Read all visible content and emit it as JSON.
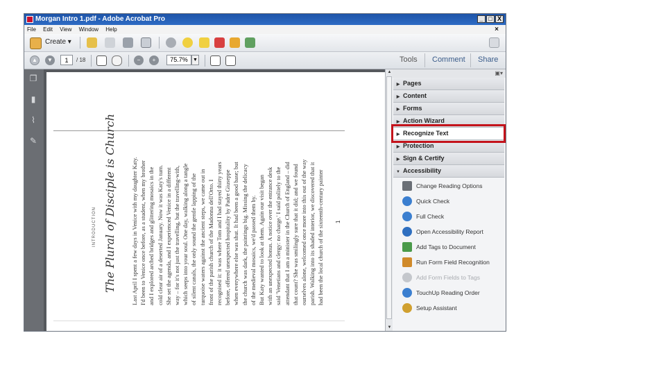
{
  "window": {
    "title": "Morgan Intro  1.pdf - Adobe Acrobat Pro",
    "min": "_",
    "max": "□",
    "close": "X"
  },
  "menu": [
    "File",
    "Edit",
    "View",
    "Window",
    "Help"
  ],
  "menu_close": "×",
  "toolbar": {
    "create_label": "Create",
    "page_current": "1",
    "page_total": "/ 18",
    "zoom": "75.7%"
  },
  "tabs": {
    "tools": "Tools",
    "comment": "Comment",
    "share": "Share"
  },
  "panel": {
    "sections": [
      {
        "label": "Pages",
        "expanded": false
      },
      {
        "label": "Content",
        "expanded": false
      },
      {
        "label": "Forms",
        "expanded": false
      },
      {
        "label": "Action Wizard",
        "expanded": false
      },
      {
        "label": "Recognize Text",
        "expanded": false,
        "highlighted": true
      },
      {
        "label": "Protection",
        "expanded": false
      },
      {
        "label": "Sign & Certify",
        "expanded": false
      },
      {
        "label": "Accessibility",
        "expanded": true
      }
    ],
    "accessibility_items": [
      {
        "label": "Change Reading Options",
        "icon": "book-icon",
        "enabled": true
      },
      {
        "label": "Quick Check",
        "icon": "check-circle-icon",
        "enabled": true
      },
      {
        "label": "Full Check",
        "icon": "full-check-icon",
        "enabled": true
      },
      {
        "label": "Open Accessibility Report",
        "icon": "report-icon",
        "enabled": true
      },
      {
        "label": "Add Tags to Document",
        "icon": "tag-icon",
        "enabled": true
      },
      {
        "label": "Run Form Field Recognition",
        "icon": "form-recognition-icon",
        "enabled": true
      },
      {
        "label": "Add Form Fields to Tags",
        "icon": "form-tags-icon",
        "enabled": false
      },
      {
        "label": "TouchUp Reading Order",
        "icon": "touchup-icon",
        "enabled": true
      },
      {
        "label": "Setup Assistant",
        "icon": "wand-icon",
        "enabled": true
      }
    ]
  },
  "document": {
    "chapter_label": "INTRODUCTION",
    "title": "The Plural of Disciple is Church",
    "page_number": "1",
    "lines": [
      "Last April I spent a few days in Venice with my daughter Katy.",
      "I'd been to Venice once before, as a student, when my brother",
      "and I explored arched bridges and glittering mosaics in the",
      "cold clear air of a deserted January. Now it was Katy's turn.",
      "She set the agenda, and I experienced Venice in a different",
      "way – for it's not just the travelling, but the travelling-with,",
      "which seeps into your soul. One day, walking along a tangle",
      "of silent canals, the only sound the gentle lapping of the",
      "turquoise waters against the ancient steps, we came out in",
      "front of the parish church of the Madonna dell'Orto. I",
      "recognised it: it was where Tom and I had stayed thirty years",
      "before, offered unexpected hospitality by Padre Giuseppe",
      "when everywhere else was shut. It had been a good base; but",
      "the church was dark, the paintings big. Missing the delicacy",
      "of the medieval mosaics, we'd passed them by.",
      "But Katy wanted to look at them. Again our visit began",
      "with an unexpected bonus. A notice over the entrance desk",
      "said 'Venetians and clergy: no charge.' I said politely to the",
      "attendant that I am a minister in the Church of England – did",
      "that count? She was smilingly sure that it did; and we found",
      "ourselves alone, welcomed once more into this out of the way",
      "parish. Walking into its shaded interior, we discovered that it",
      "had been the local church of the sixteenth-century painter"
    ]
  },
  "colors": {
    "highlight": "#c4131b",
    "panel_bg": "#f3f4f6",
    "nav_bg": "#6b6e73",
    "title_bar": "#1e54a8"
  }
}
